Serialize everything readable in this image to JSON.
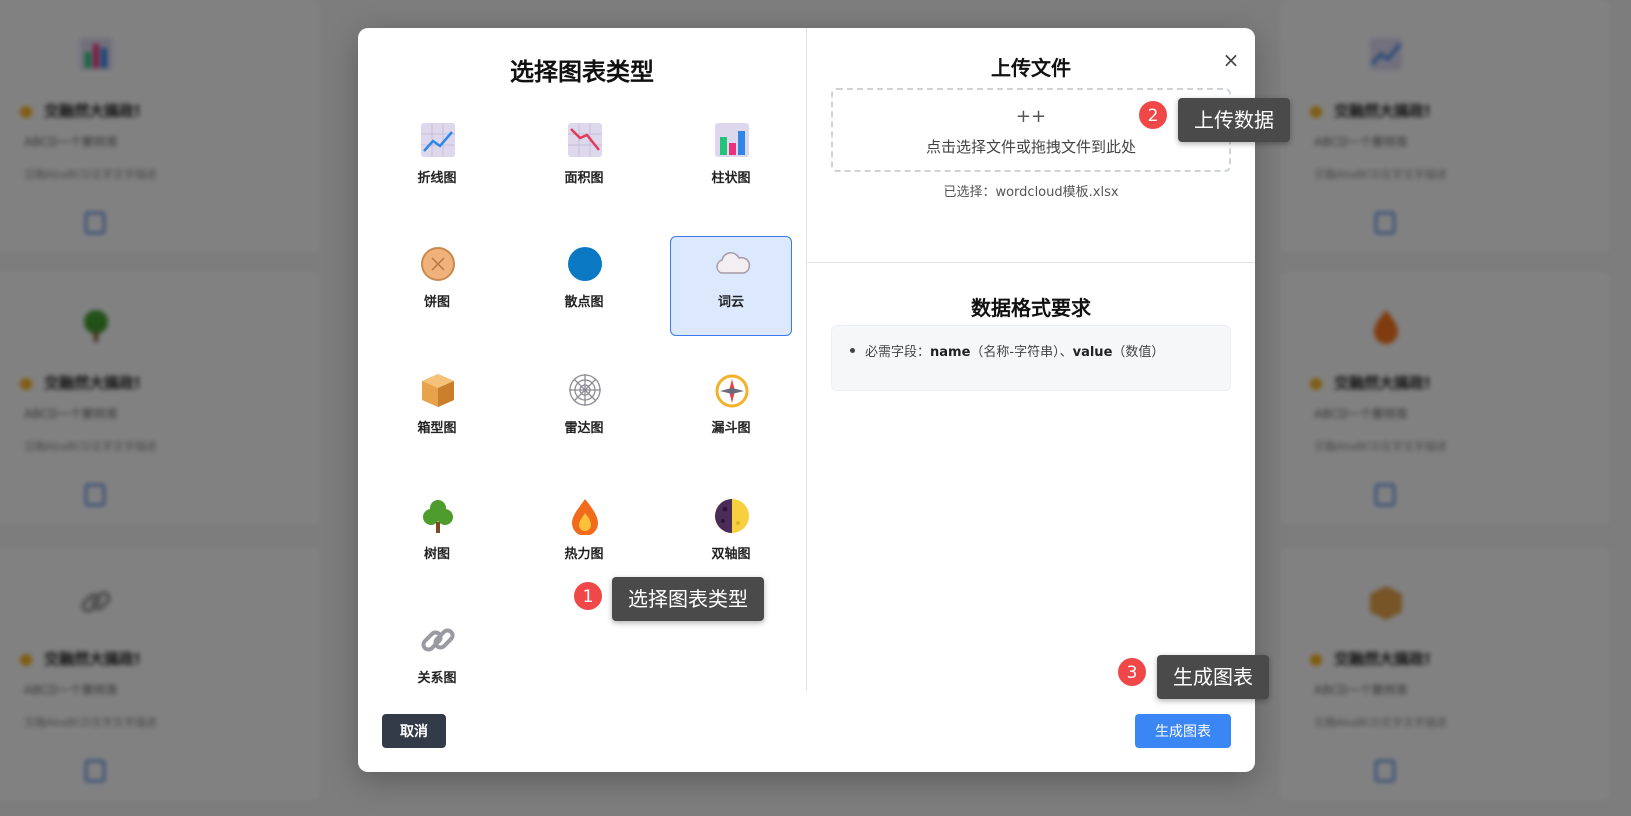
{
  "background": {
    "card_title": "交融然大搞政!",
    "card_subtitle": "ABCD一个聚样库",
    "card_note": "交融AbaBCD文字文字描述"
  },
  "modal": {
    "left_title": "选择图表类型",
    "chart_types": [
      {
        "label": "折线图",
        "icon": "line-chart-icon"
      },
      {
        "label": "面积图",
        "icon": "area-chart-icon"
      },
      {
        "label": "柱状图",
        "icon": "bar-chart-icon"
      },
      {
        "label": "饼图",
        "icon": "pie-chart-icon"
      },
      {
        "label": "散点图",
        "icon": "scatter-chart-icon"
      },
      {
        "label": "词云",
        "icon": "cloud-icon",
        "selected": true
      },
      {
        "label": "箱型图",
        "icon": "box-icon"
      },
      {
        "label": "雷达图",
        "icon": "radar-web-icon"
      },
      {
        "label": "漏斗图",
        "icon": "compass-icon"
      },
      {
        "label": "树图",
        "icon": "tree-icon"
      },
      {
        "label": "热力图",
        "icon": "fire-icon"
      },
      {
        "label": "双轴图",
        "icon": "moon-half-icon"
      },
      {
        "label": "关系图",
        "icon": "link-icon"
      }
    ],
    "upload_title": "上传文件",
    "close_symbol": "×",
    "dropzone_plus": "++",
    "dropzone_text": "点击选择文件或拖拽文件到此处",
    "selected_file": "已选择：wordcloud模板.xlsx",
    "format_title": "数据格式要求",
    "requirement": {
      "prefix": "必需字段：",
      "field1": "name",
      "desc1": "（名称-字符串）、",
      "field2": "value",
      "desc2": "（数值）"
    },
    "cancel_label": "取消",
    "generate_label": "生成图表"
  },
  "tips": [
    {
      "number": "1",
      "text": "选择图表类型"
    },
    {
      "number": "2",
      "text": "上传数据"
    },
    {
      "number": "3",
      "text": "生成图表"
    }
  ],
  "colors": {
    "primary": "#3a86f4",
    "selected_bg": "#dce9fc",
    "badge": "#f04848",
    "cancel": "#333a48"
  }
}
